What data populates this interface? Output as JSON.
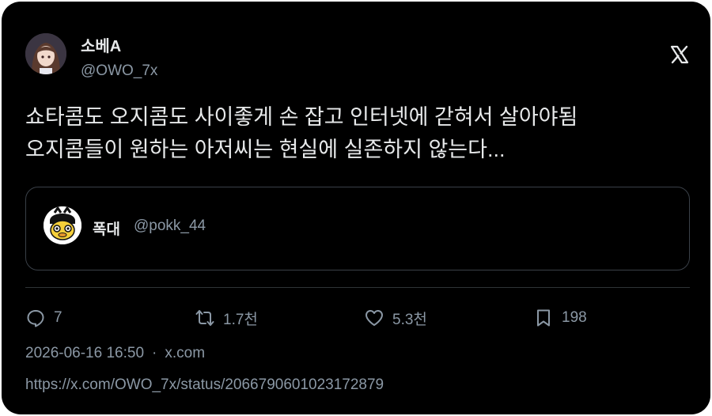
{
  "author": {
    "display_name": "소베A",
    "handle": "@OWO_7x"
  },
  "brand": {
    "logo_icon": "x-logo-icon",
    "logo_glyph": "𝕏"
  },
  "tweet": {
    "lines": [
      "쇼타콤도 오지콤도 사이좋게 손 잡고 인터넷에 갇혀서 살아야됨",
      "오지콤들이 원하는 아저씨는 현실에 실존하지 않는다..."
    ]
  },
  "quote": {
    "display_name": "폭대",
    "handle": "@pokk_44"
  },
  "actions": {
    "reply": {
      "icon": "reply-icon",
      "count": "7"
    },
    "repost": {
      "icon": "repost-icon",
      "count": "1.7천"
    },
    "like": {
      "icon": "heart-icon",
      "count": "5.3천"
    },
    "bookmark": {
      "icon": "bookmark-icon",
      "count": "198"
    }
  },
  "meta": {
    "timestamp": "2026-06-16 16:50",
    "separator": "·",
    "source": "x.com"
  },
  "url": "https://x.com/OWO_7x/status/2066790601023172879",
  "colors": {
    "background": "#000000",
    "text_primary": "#e7e9ea",
    "text_secondary": "#8b98a5",
    "border": "#3a4048"
  }
}
